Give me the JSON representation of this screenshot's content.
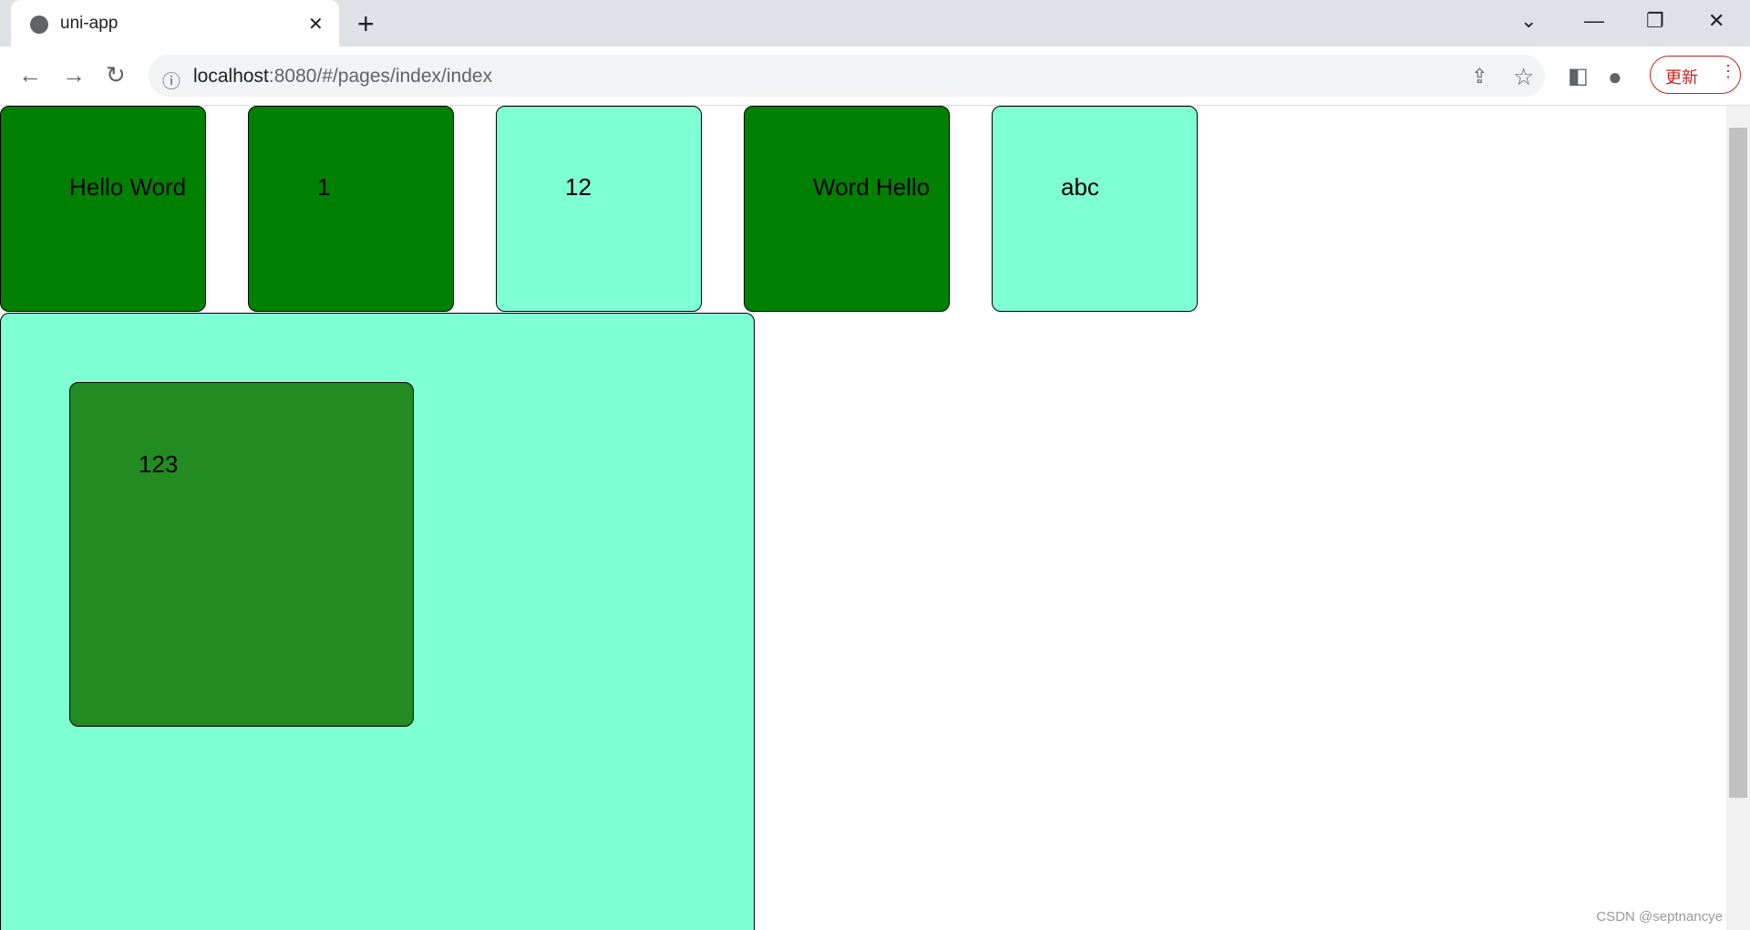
{
  "browser": {
    "tab_title": "uni-app",
    "url_host": "localhost",
    "url_rest": ":8080/#/pages/index/index",
    "update_label": "更新"
  },
  "boxes": [
    {
      "text": "Hello Word",
      "color": "#008000"
    },
    {
      "text": "1",
      "color": "#008000"
    },
    {
      "text": "12",
      "color": "#7fffd4"
    },
    {
      "text": "Word Hello",
      "color": "#008000"
    },
    {
      "text": "abc",
      "color": "#7fffd4"
    }
  ],
  "inner_box": {
    "text": "123",
    "color": "#228b22"
  },
  "watermark": "CSDN @septnancye"
}
